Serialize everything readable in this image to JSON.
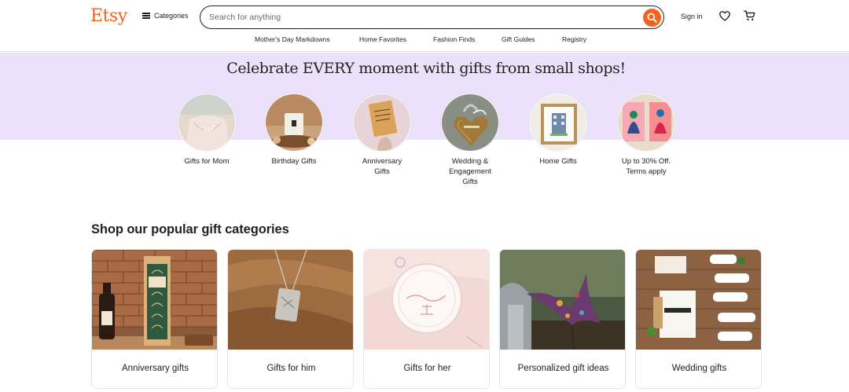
{
  "header": {
    "logo": "Etsy",
    "categories_label": "Categories",
    "search_placeholder": "Search for anything",
    "signin_label": "Sign in"
  },
  "nav": [
    "Mother's Day Markdowns",
    "Home Favorites",
    "Fashion Finds",
    "Gift Guides",
    "Registry"
  ],
  "hero": {
    "title": "Celebrate EVERY moment with gifts from small shops!",
    "circles": [
      {
        "label": "Gifts for Mom"
      },
      {
        "label": "Birthday Gifts"
      },
      {
        "label": "Anniversary\nGifts"
      },
      {
        "label": "Wedding &\nEngagement\nGifts"
      },
      {
        "label": "Home Gifts"
      },
      {
        "label": "Up to 30% Off.\nTerms apply"
      }
    ]
  },
  "popular": {
    "title": "Shop our popular gift categories",
    "cards": [
      {
        "label": "Anniversary gifts"
      },
      {
        "label": "Gifts for him"
      },
      {
        "label": "Gifts for her"
      },
      {
        "label": "Personalized gift ideas"
      },
      {
        "label": "Wedding gifts"
      }
    ]
  },
  "colors": {
    "brand": "#f1641e",
    "hero_band": "#ebe1fa",
    "text": "#222222"
  },
  "icons": [
    "menu-icon",
    "search-icon",
    "heart-icon",
    "cart-icon"
  ]
}
